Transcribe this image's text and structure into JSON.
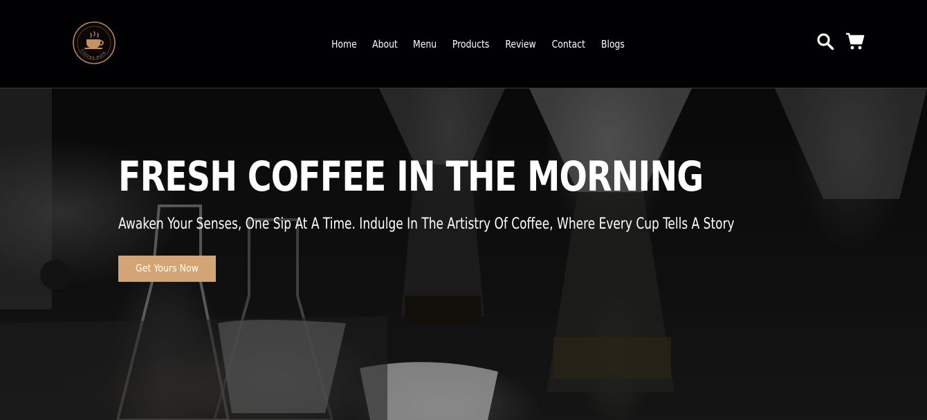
{
  "header": {
    "logo_text": "COFFEE POINT",
    "nav": [
      {
        "label": "Home"
      },
      {
        "label": "About"
      },
      {
        "label": "Menu"
      },
      {
        "label": "Products"
      },
      {
        "label": "Review"
      },
      {
        "label": "Contact"
      },
      {
        "label": "Blogs"
      }
    ],
    "icons": {
      "search": "search-icon",
      "cart": "cart-icon"
    }
  },
  "hero": {
    "title": "FRESH COFFEE IN THE MORNING",
    "subtitle": "Awaken Your Senses, One Sip At A Time. Indulge In The Artistry Of Coffee, Where Every Cup Tells A Story",
    "cta_label": "Get Yours Now"
  },
  "colors": {
    "header_bg": "#010103",
    "accent": "#d4a574",
    "logo_ring": "#b8865a",
    "text": "#ffffff"
  }
}
